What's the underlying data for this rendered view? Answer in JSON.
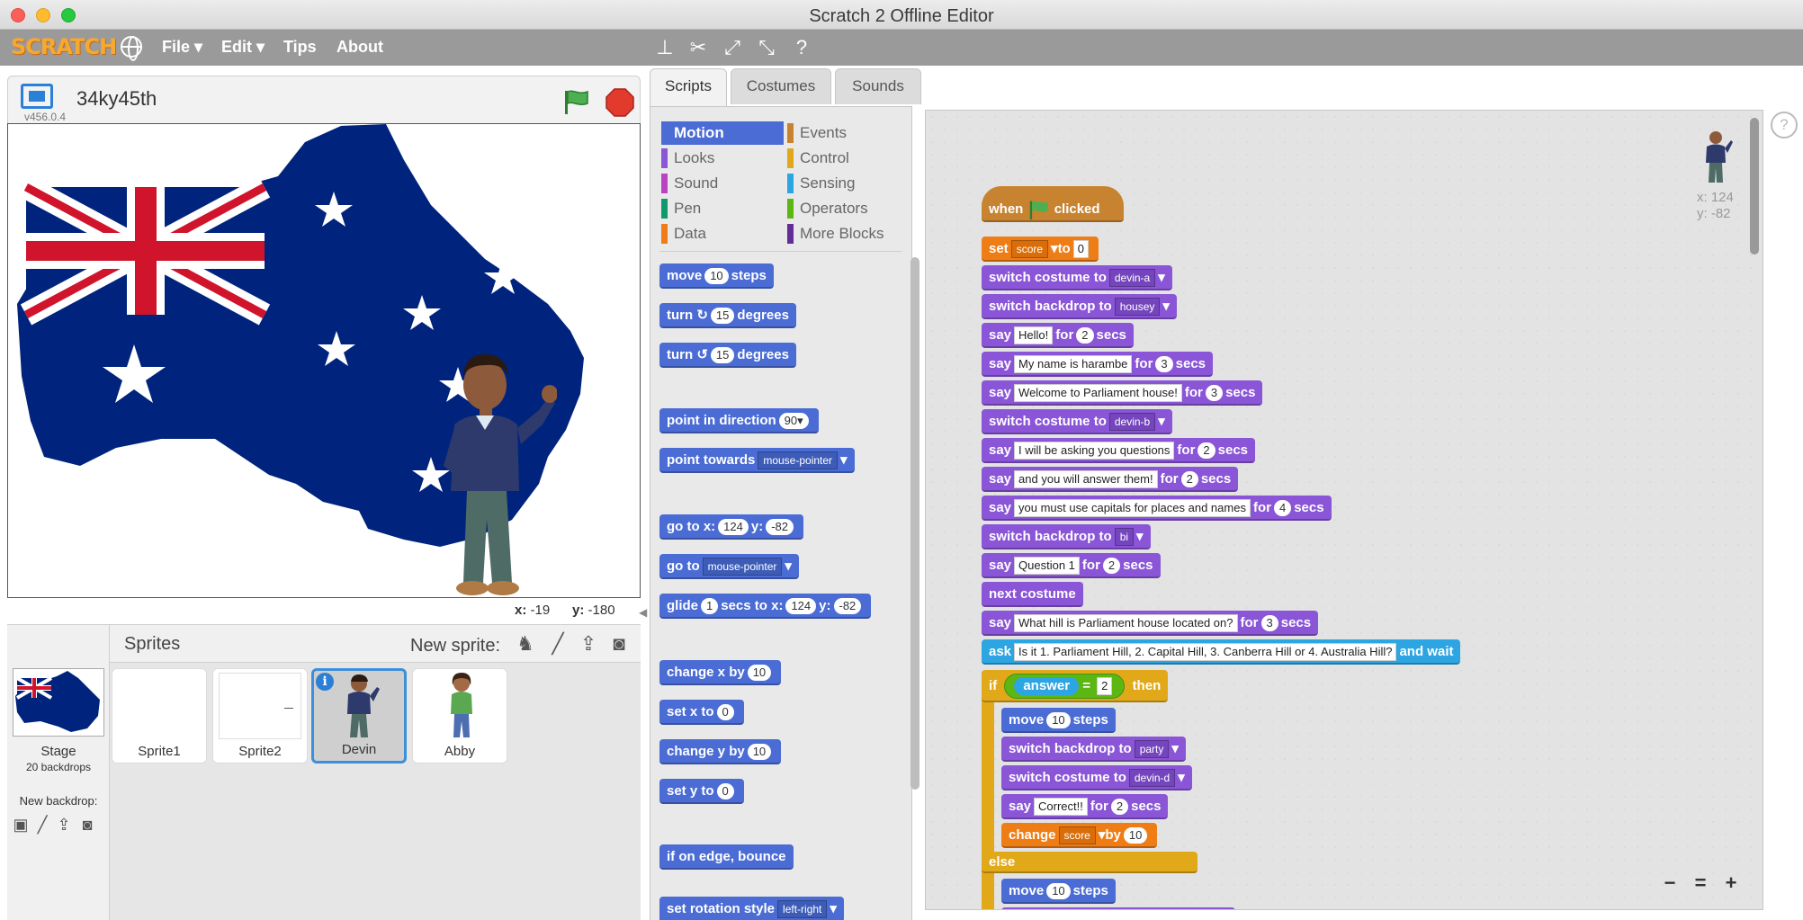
{
  "window": {
    "title": "Scratch 2 Offline Editor"
  },
  "menubar": {
    "logo": "SCRATCH",
    "file": "File ▾",
    "edit": "Edit ▾",
    "tips": "Tips",
    "about": "About"
  },
  "stage": {
    "project_title": "34ky45th",
    "version": "v456.0.4",
    "mouse_x_label": "x:",
    "mouse_x": "-19",
    "mouse_y_label": "y:",
    "mouse_y": "-180"
  },
  "sprites": {
    "header": "Sprites",
    "new_sprite": "New sprite:",
    "stage_name": "Stage",
    "backdrop_count": "20 backdrops",
    "new_backdrop": "New backdrop:",
    "items": [
      {
        "name": "Sprite1",
        "selected": false
      },
      {
        "name": "Sprite2",
        "selected": false
      },
      {
        "name": "Devin",
        "selected": true
      },
      {
        "name": "Abby",
        "selected": false
      }
    ]
  },
  "tabs": [
    "Scripts",
    "Costumes",
    "Sounds"
  ],
  "palette": {
    "categories": [
      {
        "name": "Motion",
        "color": "#4a6cd4",
        "active": true
      },
      {
        "name": "Looks",
        "color": "#8a55d7"
      },
      {
        "name": "Sound",
        "color": "#bb42c3"
      },
      {
        "name": "Pen",
        "color": "#0e9a6c"
      },
      {
        "name": "Data",
        "color": "#ee7d16"
      },
      {
        "name": "Events",
        "color": "#c88330"
      },
      {
        "name": "Control",
        "color": "#e1a91a"
      },
      {
        "name": "Sensing",
        "color": "#2ca5e2"
      },
      {
        "name": "Operators",
        "color": "#5cb712"
      },
      {
        "name": "More Blocks",
        "color": "#632d99"
      }
    ],
    "blocks": {
      "move": "move",
      "move_val": "10",
      "steps": "steps",
      "turn_right": "turn",
      "turn_right_val": "15",
      "degrees": "degrees",
      "turn_left": "turn",
      "turn_left_val": "15",
      "point_dir": "point in direction",
      "point_dir_val": "90▾",
      "point_towards": "point towards",
      "point_towards_val": "mouse-pointer",
      "goto": "go to x:",
      "goto_x": "124",
      "y_label": "y:",
      "goto_y": "-82",
      "goto_ptr": "go to",
      "goto_ptr_val": "mouse-pointer",
      "glide": "glide",
      "glide_secs": "1",
      "glide_mid": "secs to x:",
      "glide_x": "124",
      "glide_y": "-82",
      "change_x": "change x by",
      "change_x_val": "10",
      "set_x": "set x to",
      "set_x_val": "0",
      "change_y": "change y by",
      "change_y_val": "10",
      "set_y": "set y to",
      "set_y_val": "0",
      "bounce": "if on edge, bounce",
      "rotation": "set rotation style",
      "rotation_val": "left-right"
    }
  },
  "script_area": {
    "sprite_x": "x: 124",
    "sprite_y": "y: -82",
    "script": {
      "when": "when",
      "clicked": "clicked",
      "set": "set",
      "set_var": "score",
      "to": "to",
      "set_val": "0",
      "switch_costume": "switch costume to",
      "costume_a": "devin-a",
      "switch_backdrop": "switch backdrop to",
      "backdrop_housey": "housey",
      "say": "say",
      "for": "for",
      "secs": "secs",
      "say1": "Hello!",
      "say1_t": "2",
      "say2": "My name is harambe",
      "say2_t": "3",
      "say3": "Welcome to Parliament house!",
      "say3_t": "3",
      "costume_b": "devin-b",
      "say4": "I will be asking you questions",
      "say4_t": "2",
      "say5": "and you will answer them!",
      "say5_t": "2",
      "say6": "you must use capitals for places and names",
      "say6_t": "4",
      "backdrop_bi": "bi",
      "say7": "Question 1",
      "say7_t": "2",
      "next_costume": "next costume",
      "say8": "What hill is Parliament house located on?",
      "say8_t": "3",
      "ask": "ask",
      "ask_text": "Is it 1. Parliament Hill, 2. Capital Hill, 3. Canberra Hill or 4. Australia Hill?",
      "and_wait": "and wait",
      "if": "if",
      "then": "then",
      "answer": "answer",
      "eq": "=",
      "eq_val": "2",
      "move": "move",
      "move_val": "10",
      "steps": "steps",
      "backdrop_party": "party",
      "costume_d": "devin-d",
      "say9": "Correct!!",
      "say9_t": "2",
      "change": "change",
      "change_var": "score",
      "by": "by",
      "change_val": "10",
      "else": "else",
      "move2_val": "10"
    }
  }
}
